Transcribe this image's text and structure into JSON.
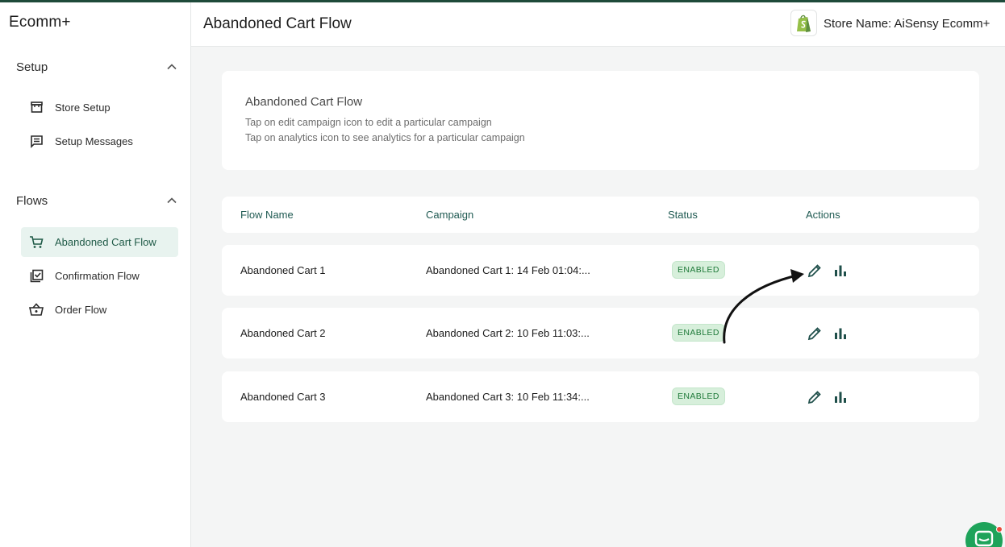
{
  "app": {
    "brand": "Ecomm+"
  },
  "sidebar": {
    "sections": [
      {
        "title": "Setup",
        "items": [
          {
            "label": "Store Setup",
            "icon": "store-icon"
          },
          {
            "label": "Setup Messages",
            "icon": "message-icon"
          }
        ]
      },
      {
        "title": "Flows",
        "items": [
          {
            "label": "Abandoned Cart Flow",
            "icon": "cart-icon",
            "active": true
          },
          {
            "label": "Confirmation Flow",
            "icon": "checklist-icon"
          },
          {
            "label": "Order Flow",
            "icon": "basket-icon"
          }
        ]
      }
    ]
  },
  "header": {
    "title": "Abandoned Cart Flow",
    "store_label": "Store Name: AiSensy Ecomm+",
    "store_logo": "shopify-icon"
  },
  "info": {
    "title": "Abandoned Cart Flow",
    "line1": "Tap on edit campaign icon to edit a particular campaign",
    "line2": "Tap on analytics icon to see analytics for a particular campaign"
  },
  "table": {
    "headers": {
      "flow_name": "Flow Name",
      "campaign": "Campaign",
      "status": "Status",
      "actions": "Actions"
    },
    "rows": [
      {
        "flow_name": "Abandoned Cart 1",
        "campaign": "Abandoned Cart 1: 14 Feb 01:04:...",
        "status": "ENABLED"
      },
      {
        "flow_name": "Abandoned Cart 2",
        "campaign": "Abandoned Cart 2: 10 Feb 11:03:...",
        "status": "ENABLED"
      },
      {
        "flow_name": "Abandoned Cart 3",
        "campaign": "Abandoned Cart 3: 10 Feb 11:34:...",
        "status": "ENABLED"
      }
    ]
  },
  "colors": {
    "accent": "#1f5a47",
    "active_bg": "#e8f3ef",
    "badge_bg": "#d7efdb",
    "badge_text": "#1f7a3a",
    "chat": "#1ea35a"
  }
}
